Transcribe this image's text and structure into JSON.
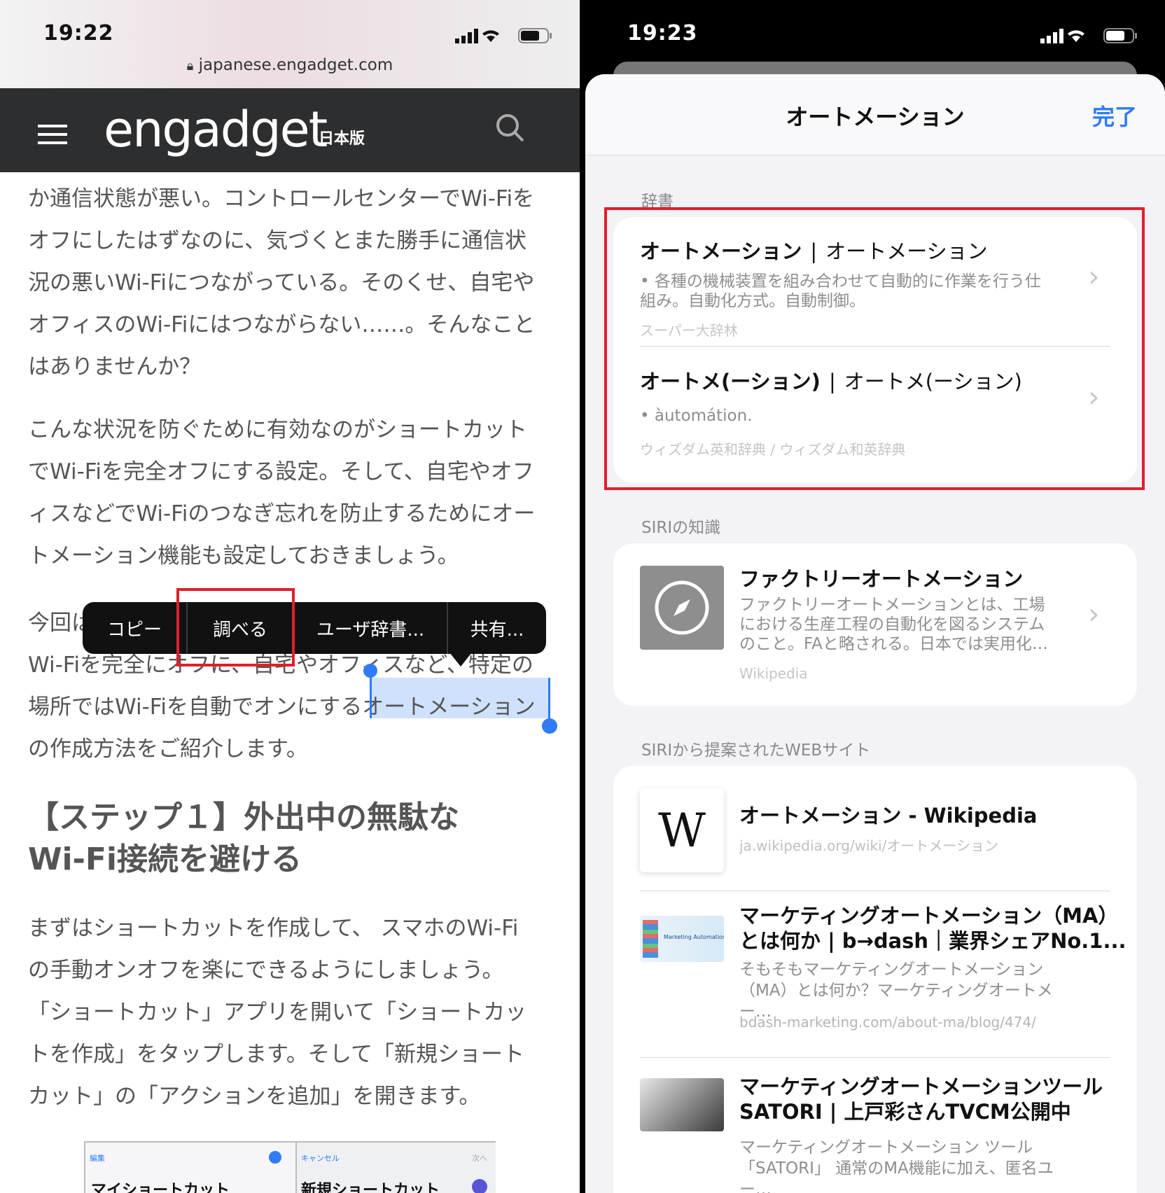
{
  "left": {
    "status": {
      "time": "19:22"
    },
    "url": "japanese.engadget.com",
    "header": {
      "logo": "engadget",
      "logo_sub": "日本版"
    },
    "paragraphs": [
      [
        "か通信状態が悪い。コントロールセンターでWi-Fiを",
        "オフにしたはずなのに、気づくとまた勝手に通信状",
        "況の悪いWi-Fiにつながっている。そのくせ、自宅や",
        "オフィスのWi-Fiにはつながらない……。そんなこと",
        "はありませんか？"
      ],
      [
        "こんな状況を防ぐために有効なのがショートカット",
        "でWi-Fiを完全オフにする設定。そして、自宅やオフ",
        "ィスなどでWi-Fiのつなぎ忘れを防止するためにオー",
        "トメーション機能も設定しておきましょう。"
      ]
    ],
    "p3": {
      "line1": "今回は",
      "line2": "Wi-Fiを完全にオフに、自宅やオフィスなど、特定の",
      "line3_a": "場所ではWi-Fiを自動でオンにする",
      "line3_sel": "オートメーション",
      "line4": "の作成方法をご紹介します。"
    },
    "heading": [
      "【ステップ１】外出中の無駄な",
      "Wi-Fi接続を避ける"
    ],
    "paragraph4": [
      "まずはショートカットを作成して、 スマホのWi-Fi",
      "の手動オンオフを楽にできるようにしましょう。",
      "「ショートカット」アプリを開いて「ショートカッ",
      "トを作成」をタップします。そして「新規ショート",
      "カット」の「アクションを追加」を開きます。"
    ],
    "context_menu": {
      "copy": "コピー",
      "lookup": "調べる",
      "user_dict": "ユーザ辞書...",
      "share": "共有..."
    },
    "thumb": {
      "left_small": "編集",
      "left_title": "マイショートカット",
      "right_small": "キャンセル",
      "right_next": "次へ",
      "right_title": "新規ショートカット"
    }
  },
  "right": {
    "status": {
      "time": "19:23"
    },
    "sheet_title": "オートメーション",
    "done": "完了",
    "dict_label": "辞書",
    "dict_entries": [
      {
        "title": "オートメーション",
        "reading": "オートメーション",
        "desc1": "• 各種の機械装置を組み合わせて自動的に作業を行う仕",
        "desc2": "組み。自動化方式。自動制御。",
        "source": "スーパー大辞林"
      },
      {
        "title": "オートメ(ーション)",
        "reading": "オートメ(ーション)",
        "desc1": "• àutomátion.",
        "desc2": "",
        "source": "ウィズダム英和辞典 / ウィズダム和英辞典"
      }
    ],
    "siri_label": "SIRIの知識",
    "siri": {
      "title": "ファクトリーオートメーション",
      "desc": [
        "ファクトリーオートメーションとは、工場",
        "における生産工程の自動化を図るシステム",
        "のこと。FAと略される。日本では実用化…"
      ],
      "source": "Wikipedia"
    },
    "web_label": "SIRIから提案されたWEBサイト",
    "sites": [
      {
        "title": [
          "オートメーション - Wikipedia"
        ],
        "desc": [],
        "url": "ja.wikipedia.org/wiki/オートメーション",
        "thumb_text": "W"
      },
      {
        "title": [
          "マーケティングオートメーション（MA）",
          "とは何か | b→dash｜業界シェアNo.1..."
        ],
        "desc": [
          "そもそもマーケティングオートメーション",
          "（MA）とは何か？マーケティングオートメー…"
        ],
        "url": "bdash-marketing.com/about-ma/blog/474/",
        "thumb_text": "Marketing Automation"
      },
      {
        "title": [
          "マーケティングオートメーションツール",
          "SATORI | 上戸彩さんTVCM公開中"
        ],
        "desc": [
          "マーケティングオートメーション ツール",
          "「SATORI」 通常のMA機能に加え、匿名ユー…"
        ],
        "url": "",
        "thumb_text": ""
      }
    ]
  },
  "colors": {
    "link_blue": "#2f7cf6",
    "highlight_red": "#e0202b",
    "selection": "#cfe1fb"
  }
}
